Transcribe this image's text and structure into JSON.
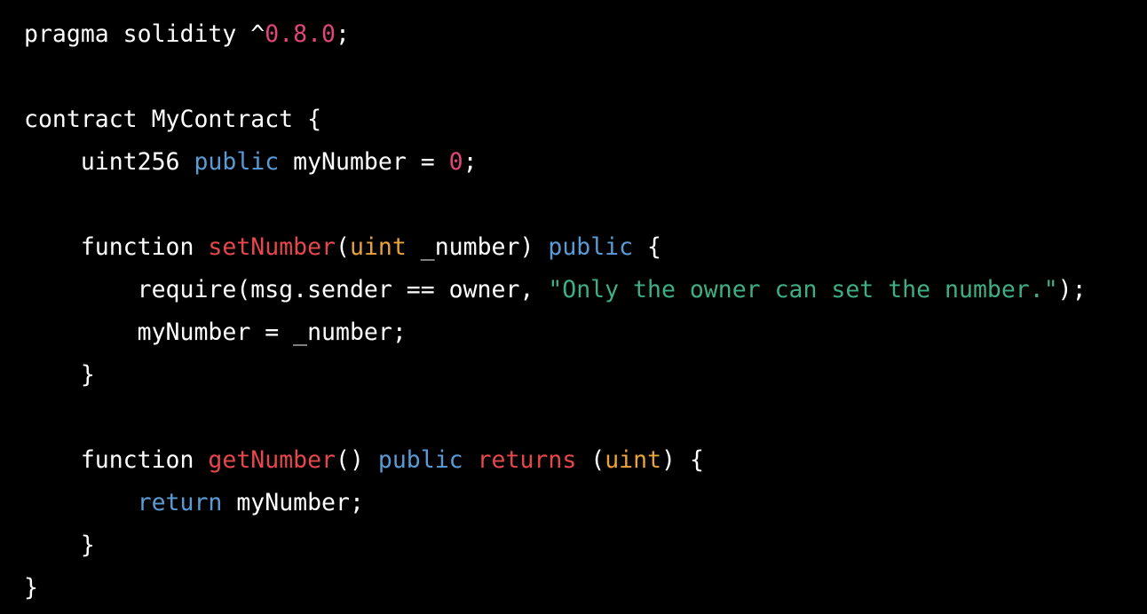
{
  "colors": {
    "background": "#000000",
    "default_text": "#ffffff",
    "number": "#e0467c",
    "keyword": "#5b9bd5",
    "function_name": "#e5474b",
    "type": "#e8a33c",
    "string": "#3fae85"
  },
  "lines": [
    [
      {
        "t": "pragma solidity ^",
        "c": "plain"
      },
      {
        "t": "0.8.0",
        "c": "num"
      },
      {
        "t": ";",
        "c": "plain"
      }
    ],
    [],
    [
      {
        "t": "contract MyContract {",
        "c": "plain"
      }
    ],
    [
      {
        "t": "    uint256 ",
        "c": "plain"
      },
      {
        "t": "public",
        "c": "kw"
      },
      {
        "t": " myNumber = ",
        "c": "plain"
      },
      {
        "t": "0",
        "c": "num"
      },
      {
        "t": ";",
        "c": "plain"
      }
    ],
    [],
    [
      {
        "t": "    function ",
        "c": "plain"
      },
      {
        "t": "setNumber",
        "c": "fn"
      },
      {
        "t": "(",
        "c": "plain"
      },
      {
        "t": "uint",
        "c": "type"
      },
      {
        "t": " _number) ",
        "c": "plain"
      },
      {
        "t": "public",
        "c": "kw"
      },
      {
        "t": " {",
        "c": "plain"
      }
    ],
    [
      {
        "t": "        require(msg.sender == owner, ",
        "c": "plain"
      },
      {
        "t": "\"Only the owner can set the number.\"",
        "c": "str"
      },
      {
        "t": ");",
        "c": "plain"
      }
    ],
    [
      {
        "t": "        myNumber = _number;",
        "c": "plain"
      }
    ],
    [
      {
        "t": "    }",
        "c": "plain"
      }
    ],
    [],
    [
      {
        "t": "    function ",
        "c": "plain"
      },
      {
        "t": "getNumber",
        "c": "fn"
      },
      {
        "t": "() ",
        "c": "plain"
      },
      {
        "t": "public",
        "c": "kw"
      },
      {
        "t": " ",
        "c": "plain"
      },
      {
        "t": "returns",
        "c": "fn"
      },
      {
        "t": " (",
        "c": "plain"
      },
      {
        "t": "uint",
        "c": "type"
      },
      {
        "t": ") {",
        "c": "plain"
      }
    ],
    [
      {
        "t": "        ",
        "c": "plain"
      },
      {
        "t": "return",
        "c": "kw"
      },
      {
        "t": " myNumber;",
        "c": "plain"
      }
    ],
    [
      {
        "t": "    }",
        "c": "plain"
      }
    ],
    [
      {
        "t": "}",
        "c": "plain"
      }
    ]
  ]
}
